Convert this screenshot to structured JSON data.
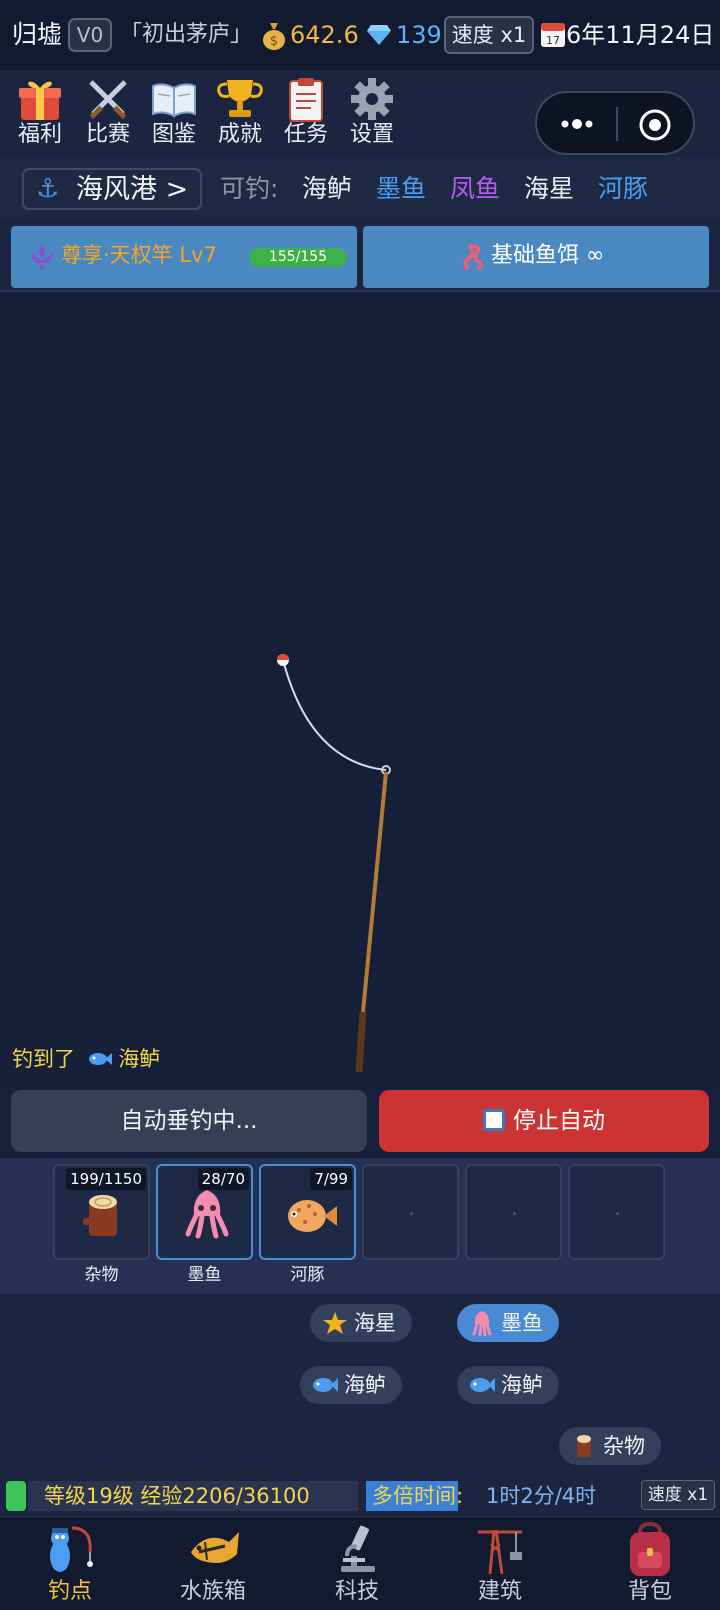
{
  "top": {
    "title": "归墟",
    "vip": "V0",
    "rank": "「初出茅庐」",
    "coins": "642.6",
    "gems": "139",
    "speed": "速度 x1",
    "date": "6年11月24日"
  },
  "menu": {
    "items": [
      {
        "label": "福利",
        "icon": "gift-icon"
      },
      {
        "label": "比赛",
        "icon": "crossed-swords-icon"
      },
      {
        "label": "图鉴",
        "icon": "book-icon"
      },
      {
        "label": "成就",
        "icon": "trophy-icon"
      },
      {
        "label": "任务",
        "icon": "clipboard-icon"
      },
      {
        "label": "设置",
        "icon": "gear-icon"
      }
    ]
  },
  "location": {
    "name": "海风港 >",
    "catchable_label": "可钓:",
    "fish": [
      {
        "name": "海鲈",
        "color": "#e8ecf4"
      },
      {
        "name": "墨鱼",
        "color": "#4a9df0"
      },
      {
        "name": "凤鱼",
        "color": "#b45cf0"
      },
      {
        "name": "海星",
        "color": "#e8ecf4"
      },
      {
        "name": "河豚",
        "color": "#4a9df0"
      }
    ]
  },
  "equipment": {
    "rod": "尊享·天权竿 Lv7",
    "durability": "155/155",
    "durability_fraction": 1.0,
    "bait": "基础鱼饵 ∞"
  },
  "scene": {
    "caught_prefix": "钓到了",
    "caught_fish": "海鲈"
  },
  "actions": {
    "auto": "自动垂钓中...",
    "stop": "停止自动"
  },
  "inventory": {
    "slots": [
      {
        "count": "199/1150",
        "label": "杂物",
        "icon": "wood-log-icon",
        "active": false
      },
      {
        "count": "28/70",
        "label": "墨鱼",
        "icon": "squid-icon",
        "active": true
      },
      {
        "count": "7/99",
        "label": "河豚",
        "icon": "pufferfish-icon",
        "active": true
      },
      {
        "count": "",
        "label": "",
        "icon": "",
        "active": false
      },
      {
        "count": "",
        "label": "",
        "icon": "",
        "active": false
      },
      {
        "count": "",
        "label": "",
        "icon": "",
        "active": false
      }
    ]
  },
  "log": {
    "chips": [
      {
        "label": "海星",
        "icon": "star-icon",
        "highlight": false
      },
      {
        "label": "墨鱼",
        "icon": "squid-icon",
        "highlight": true
      },
      {
        "label": "海鲈",
        "icon": "fish-icon",
        "highlight": false
      },
      {
        "label": "海鲈",
        "icon": "fish-icon",
        "highlight": false
      },
      {
        "label": "杂物",
        "icon": "wood-log-icon",
        "highlight": false
      }
    ]
  },
  "status": {
    "level_exp": "等级19级 经验2206/36100",
    "multi_label": "多倍时间:",
    "multi_value": "1时2分/4时",
    "speed": "速度 x1"
  },
  "nav": {
    "items": [
      {
        "label": "钓点",
        "icon": "fishing-spot-icon",
        "active": true
      },
      {
        "label": "水族箱",
        "icon": "aquarium-fish-icon",
        "active": false
      },
      {
        "label": "科技",
        "icon": "microscope-icon",
        "active": false
      },
      {
        "label": "建筑",
        "icon": "crane-icon",
        "active": false
      },
      {
        "label": "背包",
        "icon": "backpack-icon",
        "active": false
      }
    ]
  }
}
